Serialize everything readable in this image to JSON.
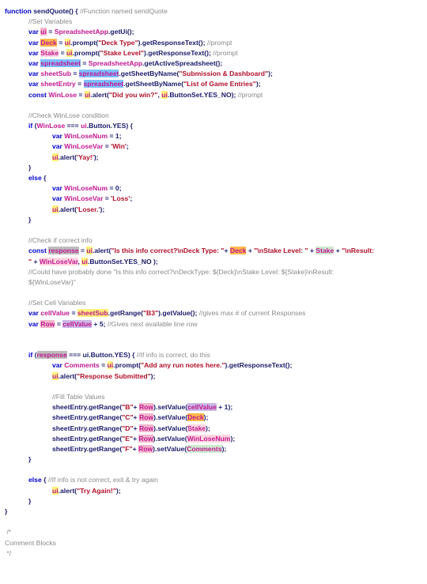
{
  "code_lines": [
    {
      "indent": 0,
      "tokens": [
        [
          "kw",
          "function "
        ],
        [
          "ob",
          "sendQuote"
        ],
        [
          "ob",
          "() { "
        ],
        [
          "cm",
          "//Function named sendQuote"
        ]
      ]
    },
    {
      "indent": 1,
      "tokens": [
        [
          "cm",
          "//Set Variables"
        ]
      ]
    },
    {
      "indent": 1,
      "tokens": [
        [
          "kw",
          "var "
        ],
        [
          "var",
          "ui",
          "hl-p"
        ],
        [
          "ob",
          " = "
        ],
        [
          "var",
          "SpreadsheetApp"
        ],
        [
          "ob",
          ".getUi();"
        ]
      ]
    },
    {
      "indent": 1,
      "tokens": [
        [
          "kw",
          "var "
        ],
        [
          "var",
          "Deck",
          "hl-o"
        ],
        [
          "ob",
          " = "
        ],
        [
          "var",
          "ui",
          "hl-y"
        ],
        [
          "ob",
          ".prompt("
        ],
        [
          "str",
          "\"Deck Type\""
        ],
        [
          "ob",
          ").getResponseText(); "
        ],
        [
          "cm",
          "//prompt"
        ]
      ]
    },
    {
      "indent": 1,
      "tokens": [
        [
          "kw",
          "var "
        ],
        [
          "var",
          "Stake",
          "hl-pk"
        ],
        [
          "ob",
          " = "
        ],
        [
          "var",
          "ui",
          "hl-y"
        ],
        [
          "ob",
          ".prompt("
        ],
        [
          "str",
          "\"Stake Level\""
        ],
        [
          "ob",
          ").getResponseText(); "
        ],
        [
          "cm",
          "//prompt"
        ]
      ]
    },
    {
      "indent": 1,
      "tokens": [
        [
          "kw",
          "var "
        ],
        [
          "var",
          "spreadsheet",
          "hl-b"
        ],
        [
          "ob",
          " = "
        ],
        [
          "var",
          "SpreadsheetApp"
        ],
        [
          "ob",
          ".getActiveSpreadsheet();"
        ]
      ]
    },
    {
      "indent": 1,
      "tokens": [
        [
          "kw",
          "var "
        ],
        [
          "var",
          "sheetSub"
        ],
        [
          "ob",
          " = "
        ],
        [
          "var",
          "spreadsheet",
          "hl-b"
        ],
        [
          "ob",
          ".getSheetByName("
        ],
        [
          "str",
          "\"Submission & Dashboard\""
        ],
        [
          "ob",
          ");"
        ]
      ]
    },
    {
      "indent": 1,
      "tokens": [
        [
          "kw",
          "var "
        ],
        [
          "var",
          "sheetEntry"
        ],
        [
          "ob",
          " = "
        ],
        [
          "var",
          "spreadsheet",
          "hl-b"
        ],
        [
          "ob",
          ".getSheetByName("
        ],
        [
          "str",
          "\"List of Game Entries\""
        ],
        [
          "ob",
          ");"
        ]
      ]
    },
    {
      "indent": 1,
      "tokens": [
        [
          "kw",
          "const "
        ],
        [
          "var",
          "WinLose"
        ],
        [
          "ob",
          " = "
        ],
        [
          "var",
          "ui",
          "hl-y"
        ],
        [
          "ob",
          ".alert("
        ],
        [
          "str",
          "\"Did you win?\""
        ],
        [
          "ob",
          ", "
        ],
        [
          "var",
          "ui",
          "hl-y"
        ],
        [
          "ob",
          ".ButtonSet.YES_NO); "
        ],
        [
          "cm",
          "//prompt"
        ]
      ]
    },
    {
      "indent": 0,
      "tokens": []
    },
    {
      "indent": 1,
      "tokens": [
        [
          "cm",
          "//Check WinLose condition"
        ]
      ]
    },
    {
      "indent": 1,
      "tokens": [
        [
          "kw",
          "if "
        ],
        [
          "ob",
          "("
        ],
        [
          "var",
          "WinLose"
        ],
        [
          "ob",
          " === "
        ],
        [
          "var",
          "ui"
        ],
        [
          "ob",
          ".Button.YES) {"
        ]
      ]
    },
    {
      "indent": 2,
      "tokens": [
        [
          "kw",
          "var "
        ],
        [
          "var",
          "WinLoseNum"
        ],
        [
          "ob",
          " = 1;"
        ]
      ]
    },
    {
      "indent": 2,
      "tokens": [
        [
          "kw",
          "var "
        ],
        [
          "var",
          "WinLoseVar"
        ],
        [
          "ob",
          " = "
        ],
        [
          "str",
          "'Win'"
        ],
        [
          "ob",
          ";"
        ]
      ]
    },
    {
      "indent": 2,
      "tokens": [
        [
          "var",
          "ui",
          "hl-y"
        ],
        [
          "ob",
          ".alert("
        ],
        [
          "str",
          "'Yay!'"
        ],
        [
          "ob",
          ");"
        ]
      ]
    },
    {
      "indent": 1,
      "tokens": [
        [
          "ob",
          "}"
        ]
      ]
    },
    {
      "indent": 1,
      "tokens": [
        [
          "kw",
          "else "
        ],
        [
          "ob",
          "{"
        ]
      ]
    },
    {
      "indent": 2,
      "tokens": [
        [
          "kw",
          "var "
        ],
        [
          "var",
          "WinLoseNum"
        ],
        [
          "ob",
          " = 0;"
        ]
      ]
    },
    {
      "indent": 2,
      "tokens": [
        [
          "kw",
          "var "
        ],
        [
          "var",
          "WinLoseVar"
        ],
        [
          "ob",
          " = "
        ],
        [
          "str",
          "'Loss'"
        ],
        [
          "ob",
          ";"
        ]
      ]
    },
    {
      "indent": 2,
      "tokens": [
        [
          "var",
          "ui",
          "hl-y"
        ],
        [
          "ob",
          ".alert("
        ],
        [
          "str",
          "'Loser.'"
        ],
        [
          "ob",
          ");"
        ]
      ]
    },
    {
      "indent": 1,
      "tokens": [
        [
          "ob",
          "}"
        ]
      ]
    },
    {
      "indent": 0,
      "tokens": []
    },
    {
      "indent": 1,
      "tokens": [
        [
          "cm",
          "//Check if correct info"
        ]
      ]
    },
    {
      "indent": 1,
      "tokens": [
        [
          "kw",
          "const "
        ],
        [
          "var",
          "response",
          "hl-k"
        ],
        [
          "ob",
          " = "
        ],
        [
          "var",
          "ui",
          "hl-y"
        ],
        [
          "ob",
          ".alert("
        ],
        [
          "str",
          "\"Is this info correct?\\nDeck Type: \""
        ],
        [
          "ob",
          "+ "
        ],
        [
          "var",
          "Deck",
          "hl-o"
        ],
        [
          "ob",
          " + "
        ],
        [
          "str",
          "\"\\nStake Level: \""
        ],
        [
          "ob",
          " + "
        ],
        [
          "var",
          "Stake",
          "hl-g"
        ],
        [
          "ob",
          " + "
        ],
        [
          "str",
          "\"\\nResult:"
        ]
      ]
    },
    {
      "indent": 1,
      "tokens": [
        [
          "str",
          "\" "
        ],
        [
          "ob",
          "+ "
        ],
        [
          "var",
          "WinLoseVar",
          "hl-pk"
        ],
        [
          "ob",
          ", "
        ],
        [
          "var",
          "ui",
          "hl-y"
        ],
        [
          "ob",
          ".ButtonSet.YES_NO );"
        ]
      ]
    },
    {
      "indent": 1,
      "tokens": [
        [
          "cm",
          "//Could have probably done \"Is this info correct?\\nDeckType: ${Deck}\\nStake Level: ${Stake}\\nResult:"
        ]
      ]
    },
    {
      "indent": 1,
      "tokens": [
        [
          "cm",
          "${WinLoseVar}\""
        ]
      ]
    },
    {
      "indent": 0,
      "tokens": []
    },
    {
      "indent": 1,
      "tokens": [
        [
          "cm",
          "//Set Cell Variables"
        ]
      ]
    },
    {
      "indent": 1,
      "tokens": [
        [
          "kw",
          "var "
        ],
        [
          "var",
          "cellValue"
        ],
        [
          "ob",
          " = "
        ],
        [
          "var",
          "sheetSub",
          "hl-y"
        ],
        [
          "ob",
          ".getRange("
        ],
        [
          "str",
          "\"B3\""
        ],
        [
          "ob",
          ").getValue(); "
        ],
        [
          "cm",
          "//gives max # of current Responses"
        ]
      ]
    },
    {
      "indent": 1,
      "tokens": [
        [
          "kw",
          "var "
        ],
        [
          "var",
          "Row",
          "hl-p"
        ],
        [
          "ob",
          " = "
        ],
        [
          "var",
          "cellValue",
          "hl-v"
        ],
        [
          "ob",
          " + 5; "
        ],
        [
          "cm",
          "//Gives next available line row"
        ]
      ]
    },
    {
      "indent": 0,
      "tokens": []
    },
    {
      "indent": 0,
      "tokens": []
    },
    {
      "indent": 1,
      "tokens": [
        [
          "kw",
          "if "
        ],
        [
          "ob",
          "("
        ],
        [
          "var",
          "response",
          "hl-k"
        ],
        [
          "ob",
          " === ui.Button.YES) { "
        ],
        [
          "cm",
          "//If info is correct, do this"
        ]
      ]
    },
    {
      "indent": 2,
      "tokens": [
        [
          "kw",
          "var "
        ],
        [
          "var",
          "Comments"
        ],
        [
          "ob",
          " = "
        ],
        [
          "var",
          "ui",
          "hl-y"
        ],
        [
          "ob",
          ".prompt("
        ],
        [
          "str",
          "\"Add any run notes here.\""
        ],
        [
          "ob",
          ").getResponseText();"
        ]
      ]
    },
    {
      "indent": 2,
      "tokens": [
        [
          "var",
          "ui",
          "hl-y"
        ],
        [
          "ob",
          ".alert("
        ],
        [
          "str",
          "\"Response Submitted\""
        ],
        [
          "ob",
          ");"
        ]
      ]
    },
    {
      "indent": 0,
      "tokens": []
    },
    {
      "indent": 2,
      "tokens": [
        [
          "cm",
          "//Fill Table Values"
        ]
      ]
    },
    {
      "indent": 2,
      "tokens": [
        [
          "ob",
          "sheetEntry.getRange("
        ],
        [
          "str",
          "\"B\""
        ],
        [
          "ob",
          "+ "
        ],
        [
          "var",
          "Row",
          "hl-p"
        ],
        [
          "ob",
          ").setValue("
        ],
        [
          "var",
          "cellValue",
          "hl-v"
        ],
        [
          "ob",
          " + 1);"
        ]
      ]
    },
    {
      "indent": 2,
      "tokens": [
        [
          "ob",
          "sheetEntry.getRange("
        ],
        [
          "str",
          "\"C\""
        ],
        [
          "ob",
          "+ "
        ],
        [
          "var",
          "Row",
          "hl-p"
        ],
        [
          "ob",
          ").setValue("
        ],
        [
          "var",
          "Deck",
          "hl-o"
        ],
        [
          "ob",
          ");"
        ]
      ]
    },
    {
      "indent": 2,
      "tokens": [
        [
          "ob",
          "sheetEntry.getRange("
        ],
        [
          "str",
          "\"D\""
        ],
        [
          "ob",
          "+ "
        ],
        [
          "var",
          "Row",
          "hl-p"
        ],
        [
          "ob",
          ").setValue("
        ],
        [
          "var",
          "Stake",
          "hl-pk"
        ],
        [
          "ob",
          ");"
        ]
      ]
    },
    {
      "indent": 2,
      "tokens": [
        [
          "ob",
          "sheetEntry.getRange("
        ],
        [
          "str",
          "\"E\""
        ],
        [
          "ob",
          "+ "
        ],
        [
          "var",
          "Row",
          "hl-p"
        ],
        [
          "ob",
          ").setValue("
        ],
        [
          "var",
          "WinLoseNum",
          "hl-pk"
        ],
        [
          "ob",
          ");"
        ]
      ]
    },
    {
      "indent": 2,
      "tokens": [
        [
          "ob",
          "sheetEntry.getRange("
        ],
        [
          "str",
          "\"F\""
        ],
        [
          "ob",
          "+ "
        ],
        [
          "var",
          "Row",
          "hl-p"
        ],
        [
          "ob",
          ").setValue("
        ],
        [
          "var",
          "Comments",
          "hl-g"
        ],
        [
          "ob",
          ");"
        ]
      ]
    },
    {
      "indent": 1,
      "tokens": [
        [
          "ob",
          "}"
        ]
      ]
    },
    {
      "indent": 0,
      "tokens": []
    },
    {
      "indent": 1,
      "tokens": [
        [
          "kw",
          "else "
        ],
        [
          "ob",
          "{ "
        ],
        [
          "cm",
          "//If info is not correct, exit & try again"
        ]
      ]
    },
    {
      "indent": 2,
      "tokens": [
        [
          "var",
          "ui",
          "hl-y"
        ],
        [
          "ob",
          ".alert("
        ],
        [
          "str",
          "\"Try Again!\""
        ],
        [
          "ob",
          ");"
        ]
      ]
    },
    {
      "indent": 1,
      "tokens": [
        [
          "ob",
          "}"
        ]
      ]
    },
    {
      "indent": 0,
      "tokens": [
        [
          "ob",
          "}"
        ]
      ]
    },
    {
      "indent": 0,
      "tokens": []
    },
    {
      "indent": 0,
      "tokens": [
        [
          "cm",
          " /*"
        ]
      ]
    },
    {
      "indent": 0,
      "tokens": [
        [
          "cm",
          "Comment Blocks"
        ]
      ]
    },
    {
      "indent": 0,
      "tokens": [
        [
          "cm",
          " */"
        ]
      ]
    }
  ]
}
